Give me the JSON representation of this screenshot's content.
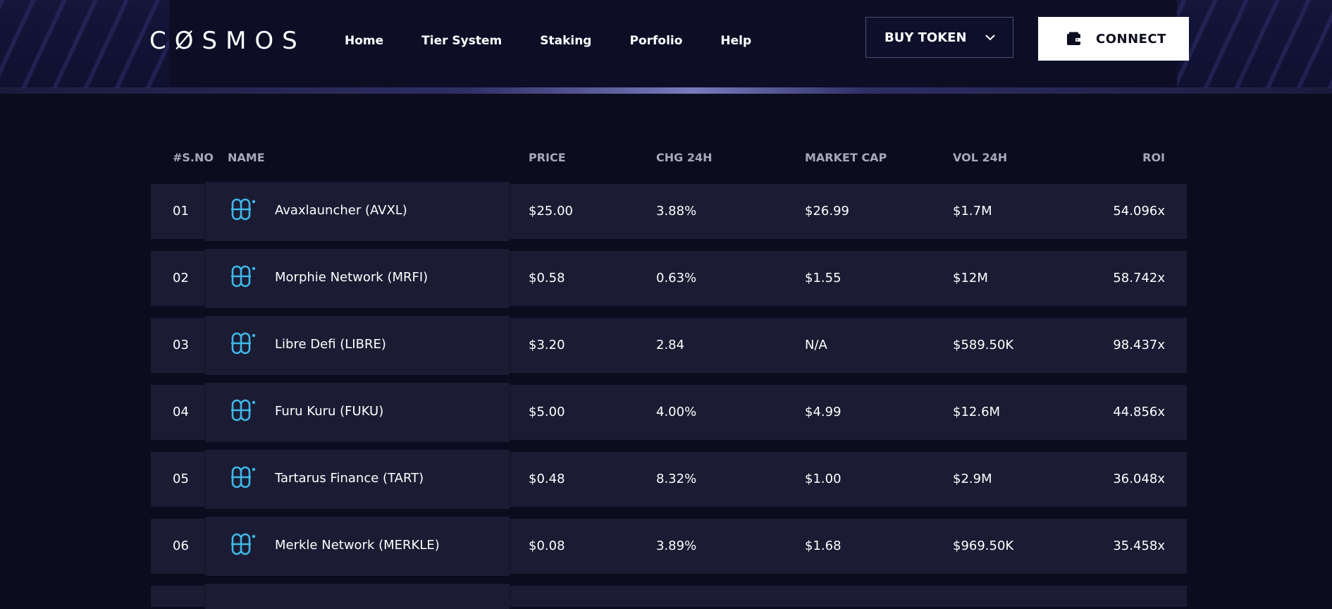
{
  "header": {
    "logo_text": "CØSMOS",
    "nav": [
      {
        "label": "Home"
      },
      {
        "label": "Tier System"
      },
      {
        "label": "Staking"
      },
      {
        "label": "Porfolio"
      },
      {
        "label": "Help"
      }
    ],
    "buy_token_label": "BUY TOKEN",
    "connect_label": "CONNECT",
    "icons": {
      "buy_token": "chevron-down-icon",
      "connect": "wallet-icon"
    }
  },
  "table": {
    "columns": {
      "sno": "#S.NO",
      "name": "NAME",
      "price": "PRICE",
      "chg": "CHG 24H",
      "mcap": "MARKET CAP",
      "vol": "VOL 24H",
      "roi": "ROI"
    },
    "rows": [
      {
        "sno": "01",
        "name": "Avaxlauncher (AVXL)",
        "price": "$25.00",
        "chg": "3.88%",
        "mcap": "$26.99",
        "vol": "$1.7M",
        "roi": "54.096x"
      },
      {
        "sno": "02",
        "name": "Morphie Network (MRFI)",
        "price": "$0.58",
        "chg": "0.63%",
        "mcap": "$1.55",
        "vol": "$12M",
        "roi": "58.742x"
      },
      {
        "sno": "03",
        "name": "Libre Defi (LIBRE)",
        "price": "$3.20",
        "chg": "2.84",
        "mcap": "N/A",
        "vol": "$589.50K",
        "roi": "98.437x"
      },
      {
        "sno": "04",
        "name": "Furu Kuru (FUKU)",
        "price": "$5.00",
        "chg": "4.00%",
        "mcap": "$4.99",
        "vol": "$12.6M",
        "roi": "44.856x"
      },
      {
        "sno": "05",
        "name": "Tartarus Finance (TART)",
        "price": "$0.48",
        "chg": "8.32%",
        "mcap": "$1.00",
        "vol": "$2.9M",
        "roi": "36.048x"
      },
      {
        "sno": "06",
        "name": "Merkle Network (MERKLE)",
        "price": "$0.08",
        "chg": "3.89%",
        "mcap": "$1.68",
        "vol": "$969.50K",
        "roi": "35.458x"
      }
    ],
    "token_icon": "token-logo-icon",
    "colors": {
      "row_bg": "#1b1c33",
      "page_bg": "#0b0c1d",
      "icon_accent": "#3fb8e8"
    }
  }
}
